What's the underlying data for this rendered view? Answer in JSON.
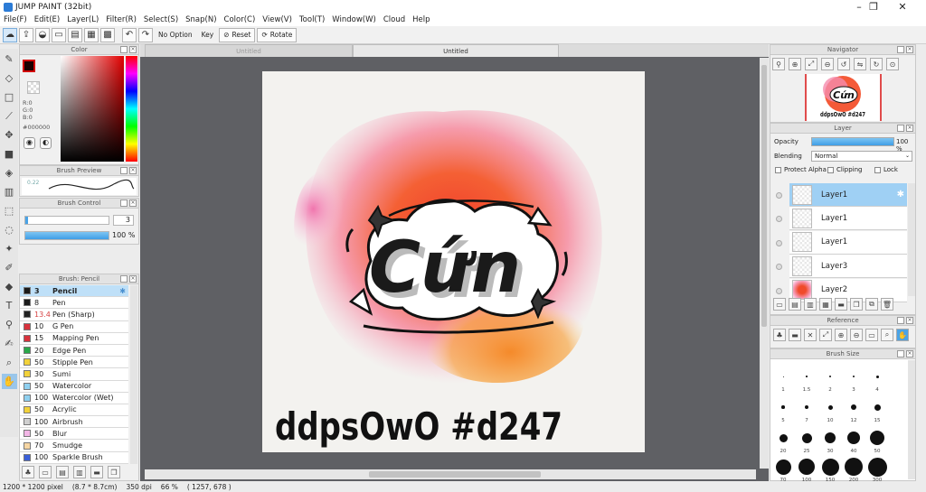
{
  "window": {
    "title": "JUMP PAINT (32bit)",
    "minimize": "–",
    "maximize": "❐",
    "close": "✕"
  },
  "menu": [
    "File(F)",
    "Edit(E)",
    "Layer(L)",
    "Filter(R)",
    "Select(S)",
    "Snap(N)",
    "Color(C)",
    "View(V)",
    "Tool(T)",
    "Window(W)",
    "Cloud",
    "Help"
  ],
  "toolbar": {
    "no_option": "No Option",
    "key": "Key",
    "reset": "Reset",
    "rotate": "Rotate"
  },
  "tabs": {
    "left": "Untitled",
    "right": "Untitled"
  },
  "color_panel": {
    "title": "Color",
    "r": "R:0",
    "g": "G:0",
    "b": "B:0",
    "hex": "#000000",
    "fg_color": "#1a0000",
    "bg_color": "#ffffff"
  },
  "brush_preview": {
    "title": "Brush Preview",
    "size_hint": "0.22"
  },
  "brush_control": {
    "title": "Brush Control",
    "size_value": "3",
    "opacity_value": "100 %",
    "opacity_fraction": 1.0
  },
  "brush_list": {
    "title": "Brush: Pencil",
    "items": [
      {
        "size": "3",
        "name": "Pencil",
        "color": "#1a1a1a",
        "selected": true
      },
      {
        "size": "8",
        "name": "Pen",
        "color": "#1a1a1a"
      },
      {
        "size": "13.4",
        "name": "Pen (Sharp)",
        "color": "#222222"
      },
      {
        "size": "10",
        "name": "G Pen",
        "color": "#d8323c"
      },
      {
        "size": "15",
        "name": "Mapping Pen",
        "color": "#d8323c"
      },
      {
        "size": "20",
        "name": "Edge Pen",
        "color": "#2aa84a"
      },
      {
        "size": "50",
        "name": "Stipple Pen",
        "color": "#f2d23a"
      },
      {
        "size": "30",
        "name": "Sumi",
        "color": "#f2d23a"
      },
      {
        "size": "50",
        "name": "Watercolor",
        "color": "#8fd0f0"
      },
      {
        "size": "100",
        "name": "Watercolor (Wet)",
        "color": "#8fd0f0"
      },
      {
        "size": "50",
        "name": "Acrylic",
        "color": "#f2d23a"
      },
      {
        "size": "100",
        "name": "Airbrush",
        "color": "#cfcfcf"
      },
      {
        "size": "50",
        "name": "Blur",
        "color": "#f3b6e6"
      },
      {
        "size": "70",
        "name": "Smudge",
        "color": "#f7d6a3"
      },
      {
        "size": "100",
        "name": "Sparkle Brush",
        "color": "#3a5fd8"
      }
    ]
  },
  "navigator": {
    "title": "Navigator"
  },
  "layer_panel": {
    "title": "Layer",
    "opacity_label": "Opacity",
    "opacity_value": "100 %",
    "opacity_fraction": 1.0,
    "blending_label": "Blending",
    "blending_value": "Normal",
    "protect_alpha": "Protect Alpha",
    "clipping": "Clipping",
    "lock": "Lock",
    "layers": [
      {
        "name": "Layer1",
        "selected": true
      },
      {
        "name": "Layer1"
      },
      {
        "name": "Layer1"
      },
      {
        "name": "Layer3"
      },
      {
        "name": "Layer2"
      }
    ]
  },
  "reference": {
    "title": "Reference"
  },
  "brush_size": {
    "title": "Brush Size",
    "rows": [
      [
        "1",
        "1.5",
        "2",
        "3",
        "4"
      ],
      [
        "5",
        "7",
        "10",
        "12",
        "15"
      ],
      [
        "20",
        "25",
        "30",
        "40",
        "50"
      ],
      [
        "70",
        "100",
        "150",
        "200",
        "300"
      ]
    ]
  },
  "artwork": {
    "logo_text": "Cứn",
    "signature": "ddpsOwO #d247"
  },
  "status": {
    "size": "1200 * 1200 pixel",
    "dims": "(8.7 * 8.7cm)",
    "dpi": "350 dpi",
    "zoom": "66 %",
    "coords": "( 1257, 678 )"
  }
}
